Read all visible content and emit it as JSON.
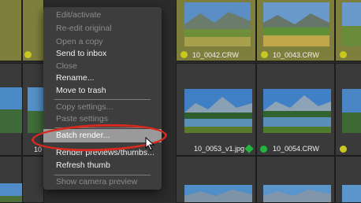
{
  "menu": {
    "items": [
      {
        "label": "Edit/activate",
        "enabled": false
      },
      {
        "label": "Re-edit original",
        "enabled": false
      },
      {
        "label": "Open a copy",
        "enabled": false
      },
      {
        "label": "Send to inbox",
        "enabled": true
      },
      {
        "label": "Close",
        "enabled": false
      },
      {
        "label": "Rename...",
        "enabled": true
      },
      {
        "label": "Move to trash",
        "enabled": true
      },
      {
        "label": "Copy settings...",
        "enabled": false
      },
      {
        "label": "Paste settings",
        "enabled": false
      },
      {
        "label": "Batch render...",
        "enabled": true,
        "highlighted": true
      },
      {
        "label": "Render previews/thumbs...",
        "enabled": true
      },
      {
        "label": "Refresh thumb",
        "enabled": true
      },
      {
        "label": "Show camera preview",
        "enabled": false
      }
    ]
  },
  "thumbnails": {
    "row1": [
      {
        "filename": "",
        "label_color": "#c8c81e"
      },
      {
        "filename": "10_0042.CRW",
        "label_color": "#c8c81e"
      },
      {
        "filename": "10_0043.CRW",
        "label_color": "#c8c81e"
      },
      {
        "filename": "",
        "label_color": "#c8c81e"
      }
    ],
    "row2": [
      {
        "filename": "10",
        "label_color": ""
      },
      {
        "filename": "10_0053_v1.jpg",
        "label_color": "#22b43c"
      },
      {
        "filename": "10_0054.CRW",
        "label_color": "#22b43c"
      },
      {
        "filename": "",
        "label_color": "#c8c81e"
      }
    ]
  },
  "annotation_color": "#d72a1f"
}
